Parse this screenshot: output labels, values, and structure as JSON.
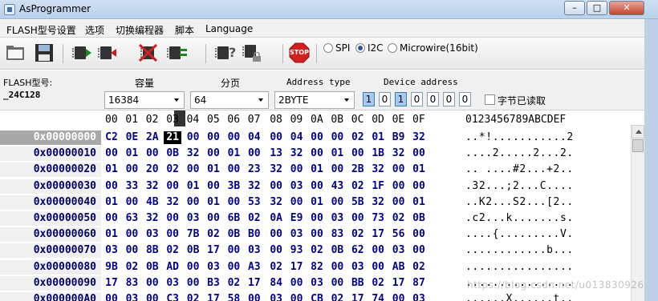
{
  "window": {
    "title": "AsProgrammer",
    "min": "–",
    "max": "□",
    "close": "✕"
  },
  "menu": [
    "FLASH型号设置",
    "选项",
    "切换编程器",
    "脚本",
    "Language"
  ],
  "toolbar": {
    "icons": [
      "open-icon",
      "save-icon",
      "read-icon",
      "write-icon",
      "erase-icon",
      "verify-icon",
      "chip-info-icon",
      "chip-lock-icon",
      "stop-icon"
    ],
    "stop_label": "STOP",
    "protocols": [
      {
        "label": "SPI",
        "selected": false
      },
      {
        "label": "I2C",
        "selected": true
      },
      {
        "label": "Microwire(16bit)",
        "selected": false
      }
    ]
  },
  "settings": {
    "flash_model_label": "FLASH型号:",
    "flash_model_value": "_24C128",
    "capacity_label": "容量",
    "capacity_value": "16384",
    "page_label": "分页",
    "page_value": "64",
    "address_type_label": "Address type",
    "address_type_value": "2BYTE",
    "device_address_label": "Device address",
    "device_address_bits": [
      "1",
      "0",
      "1",
      "0",
      "0",
      "0",
      "0"
    ],
    "device_address_on": [
      true,
      false,
      true,
      false,
      false,
      false,
      false
    ],
    "bytes_read_label": "字节已读取",
    "bytes_read_checked": false
  },
  "hex": {
    "header_cols": [
      "00",
      "01",
      "02",
      "03",
      "04",
      "05",
      "06",
      "07",
      "08",
      "09",
      "0A",
      "0B",
      "0C",
      "0D",
      "0E",
      "0F"
    ],
    "ascii_header": "0123456789ABCDEF",
    "rows": [
      {
        "addr": "0x00000000",
        "bytes": [
          "C2",
          "0E",
          "2A",
          "21",
          "00",
          "00",
          "00",
          "04",
          "00",
          "04",
          "00",
          "00",
          "02",
          "01",
          "B9",
          "32"
        ],
        "ascii": "..*!...........2"
      },
      {
        "addr": "0x00000010",
        "bytes": [
          "00",
          "01",
          "00",
          "0B",
          "32",
          "00",
          "01",
          "00",
          "13",
          "32",
          "00",
          "01",
          "00",
          "1B",
          "32",
          "00"
        ],
        "ascii": "....2.....2...2."
      },
      {
        "addr": "0x00000020",
        "bytes": [
          "01",
          "00",
          "20",
          "02",
          "00",
          "01",
          "00",
          "23",
          "32",
          "00",
          "01",
          "00",
          "2B",
          "32",
          "00",
          "01"
        ],
        "ascii": ".. ....#2...+2.."
      },
      {
        "addr": "0x00000030",
        "bytes": [
          "00",
          "33",
          "32",
          "00",
          "01",
          "00",
          "3B",
          "32",
          "00",
          "03",
          "00",
          "43",
          "02",
          "1F",
          "00",
          "00"
        ],
        "ascii": ".32...;2...C...."
      },
      {
        "addr": "0x00000040",
        "bytes": [
          "01",
          "00",
          "4B",
          "32",
          "00",
          "01",
          "00",
          "53",
          "32",
          "00",
          "01",
          "00",
          "5B",
          "32",
          "00",
          "01"
        ],
        "ascii": "..K2...S2...[2.."
      },
      {
        "addr": "0x00000050",
        "bytes": [
          "00",
          "63",
          "32",
          "00",
          "03",
          "00",
          "6B",
          "02",
          "0A",
          "E9",
          "00",
          "03",
          "00",
          "73",
          "02",
          "0B"
        ],
        "ascii": ".c2...k.......s."
      },
      {
        "addr": "0x00000060",
        "bytes": [
          "01",
          "00",
          "03",
          "00",
          "7B",
          "02",
          "0B",
          "B0",
          "00",
          "03",
          "00",
          "83",
          "02",
          "17",
          "56",
          "00"
        ],
        "ascii": "....{.........V."
      },
      {
        "addr": "0x00000070",
        "bytes": [
          "03",
          "00",
          "8B",
          "02",
          "0B",
          "17",
          "00",
          "03",
          "00",
          "93",
          "02",
          "0B",
          "62",
          "00",
          "03",
          "00"
        ],
        "ascii": "............b..."
      },
      {
        "addr": "0x00000080",
        "bytes": [
          "9B",
          "02",
          "0B",
          "AD",
          "00",
          "03",
          "00",
          "A3",
          "02",
          "17",
          "82",
          "00",
          "03",
          "00",
          "AB",
          "02"
        ],
        "ascii": "................"
      },
      {
        "addr": "0x00000090",
        "bytes": [
          "17",
          "83",
          "00",
          "03",
          "00",
          "B3",
          "02",
          "17",
          "84",
          "00",
          "03",
          "00",
          "BB",
          "02",
          "17",
          "87"
        ],
        "ascii": "................"
      },
      {
        "addr": "0x000000A0",
        "bytes": [
          "00",
          "03",
          "00",
          "C3",
          "02",
          "17",
          "58",
          "00",
          "03",
          "00",
          "CB",
          "02",
          "17",
          "74",
          "00",
          "03"
        ],
        "ascii": "......X......t.."
      }
    ],
    "cursor": {
      "row": 0,
      "col": 3
    }
  },
  "watermark": "https://blog.csdn.net/u013830926"
}
